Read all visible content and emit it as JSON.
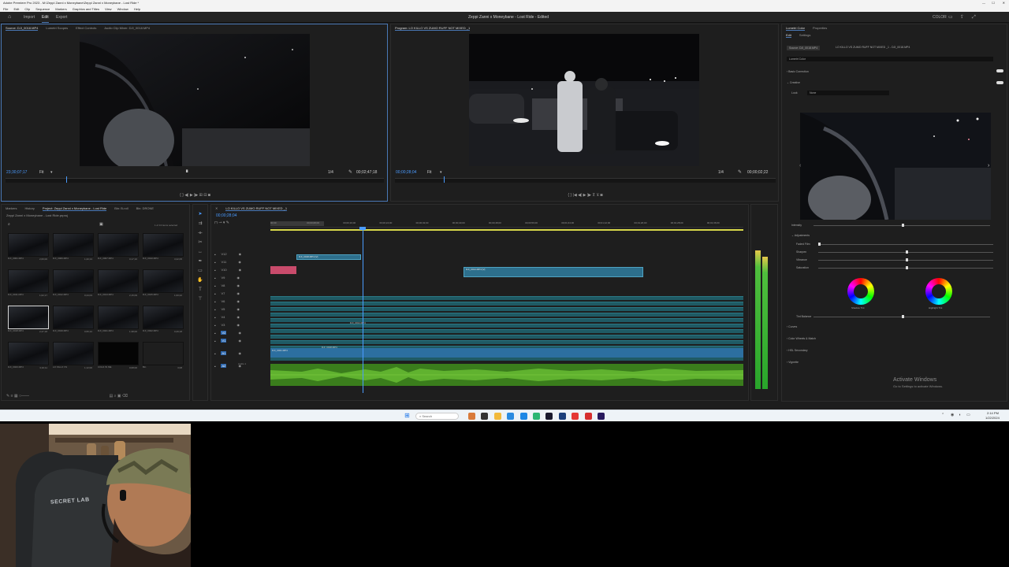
{
  "titlebar": {
    "title": "Adobe Premiere Pro 2023 - M:\\Zeppi Zanni x Moneybane\\Zeppi Zanni x Moneybane - Lost Ride *",
    "controls": [
      "—",
      "☐",
      "✕"
    ]
  },
  "menubar": {
    "items": [
      "File",
      "Edit",
      "Clip",
      "Sequence",
      "Markers",
      "Graphics and Titles",
      "View",
      "Window",
      "Help"
    ]
  },
  "workspace": {
    "tabs": [
      "Import",
      "Edit",
      "Export"
    ],
    "active_tab": "Edit",
    "project_title": "Zeppi Zanni x Moneybane - Lost Ride - Edited",
    "right_label": "COLOR"
  },
  "source_monitor": {
    "tabs": [
      "Source: DJI_0018.MP4",
      "Lumetri Scopes",
      "Effect Controls",
      "Audio Clip Mixer: DJI_0018.MP4"
    ],
    "timecode": "23;30;07;17",
    "fit": "Fit",
    "quality": "1/4",
    "duration": "00;02;47;18"
  },
  "program_monitor": {
    "tabs": [
      "Program: LO KILLO VS ZUMO RUFF NOT MIXED _1"
    ],
    "timecode": "00;00;28;04",
    "fit": "Fit",
    "quality": "1/4",
    "duration": "00;00;02;22"
  },
  "project_panel": {
    "tabs": [
      "Markers",
      "History",
      "Project: Zeppi Zanni x Moneybane - Lost Ride",
      "Bin: B-roll",
      "Bin: DRONE"
    ],
    "project_file": "Zeppi Zanni x Moneybane - Lost Ride.prproj",
    "selection_info": "1 of 13 items selected",
    "items": [
      {
        "name": "DJI_0001.MP4",
        "dur": "2;06;00"
      },
      {
        "name": "DJI_0006.MP4",
        "dur": "1;20;13"
      },
      {
        "name": "DJI_0007.MP4",
        "dur": "0;17;10"
      },
      {
        "name": "DJI_0010.MP4",
        "dur": "3;22;05"
      },
      {
        "name": "DJI_0011.MP4",
        "dur": "1;02;17"
      },
      {
        "name": "DJI_0012.MP4",
        "dur": "0;44;03"
      },
      {
        "name": "DJI_0014.MP4",
        "dur": "2;15;09"
      },
      {
        "name": "DJI_0015.MP4",
        "dur": "1;00;22"
      },
      {
        "name": "DJI_0018.MP4",
        "dur": "2;47;18"
      },
      {
        "name": "DJI_0019.MP4",
        "dur": "0;55;12"
      },
      {
        "name": "DJI_0021.MP4",
        "dur": "1;38;00"
      },
      {
        "name": "DJI_0022.MP4",
        "dur": "0;29;18"
      },
      {
        "name": "DJI_0023.MP4",
        "dur": "3;10;11"
      },
      {
        "name": "LO KILLO VS",
        "dur": "1;12;00"
      },
      {
        "name": "COLD IN ME",
        "dur": "0;08;00"
      },
      {
        "name": "Bin",
        "dur": "3;08"
      }
    ]
  },
  "timeline": {
    "sequence_tab": "LO KILLO VS ZUMO RUFF NOT MIXED _1",
    "timecode": "00;00;28;04",
    "ruler": [
      "00;00",
      "00;00;08;00",
      "00;00;16;00",
      "00;00;24;00",
      "00;00;32;00",
      "00;00;40;00",
      "00;00;48;00",
      "00;00;56;00",
      "00;01;04;00",
      "00;01;12;00",
      "00;01;20;00",
      "00;01;28;00",
      "00;01;36;00"
    ],
    "tracks": [
      "V12",
      "V11",
      "V10",
      "V9",
      "V8",
      "V7",
      "V6",
      "V5",
      "V4",
      "V3",
      "V2",
      "V1",
      "A1",
      "A2"
    ],
    "clips": [
      {
        "label": "DJI_0018.MP4 [V]"
      },
      {
        "label": "DJI_0014.MP4 [V]"
      },
      {
        "label": "DJI_0014.MP4"
      },
      {
        "label": "DJI_0018.MP4"
      },
      {
        "label": "DJI_0021.MP4"
      }
    ],
    "audio_label": "Audio 1"
  },
  "lumetri": {
    "tabs": [
      "Lumetri Color",
      "Properties"
    ],
    "subtabs": [
      "Edit",
      "Settings"
    ],
    "clip_source": "Source: DJI_0018.MP4",
    "clip_target": "LO KILLO VS ZUMO RUFF NOT MIXED _1 - DJI_0018.MP4",
    "effect": "Lumetri Color",
    "sections": [
      "Basic Correction",
      "Creative",
      "Curves",
      "Color Wheels & Match",
      "HSL Secondary",
      "Vignette"
    ],
    "look_label": "Look",
    "look_value": "None",
    "intensity_label": "Intensity",
    "adjustments_label": "Adjustments",
    "sliders": [
      {
        "label": "Faded Film",
        "pct": 0
      },
      {
        "label": "Sharpen",
        "pct": 50
      },
      {
        "label": "Vibrance",
        "pct": 50
      },
      {
        "label": "Saturation",
        "pct": 50
      }
    ],
    "wheels": [
      "Shadow Tint",
      "Highlight Tint"
    ],
    "tint_balance_label": "Tint Balance",
    "watermark_title": "Activate Windows",
    "watermark_sub": "Go to Settings to activate Windows."
  },
  "taskbar": {
    "search_placeholder": "Search",
    "time": "2:14 PM",
    "date": "1/22/2024"
  },
  "webcam": {
    "chair_brand": "SECRET LAB"
  },
  "colors": {
    "accent_blue": "#4a78b5",
    "clip_blue": "#2d6f8c",
    "audio_green": "#3a7d1c",
    "playhead": "#4a9bff"
  }
}
